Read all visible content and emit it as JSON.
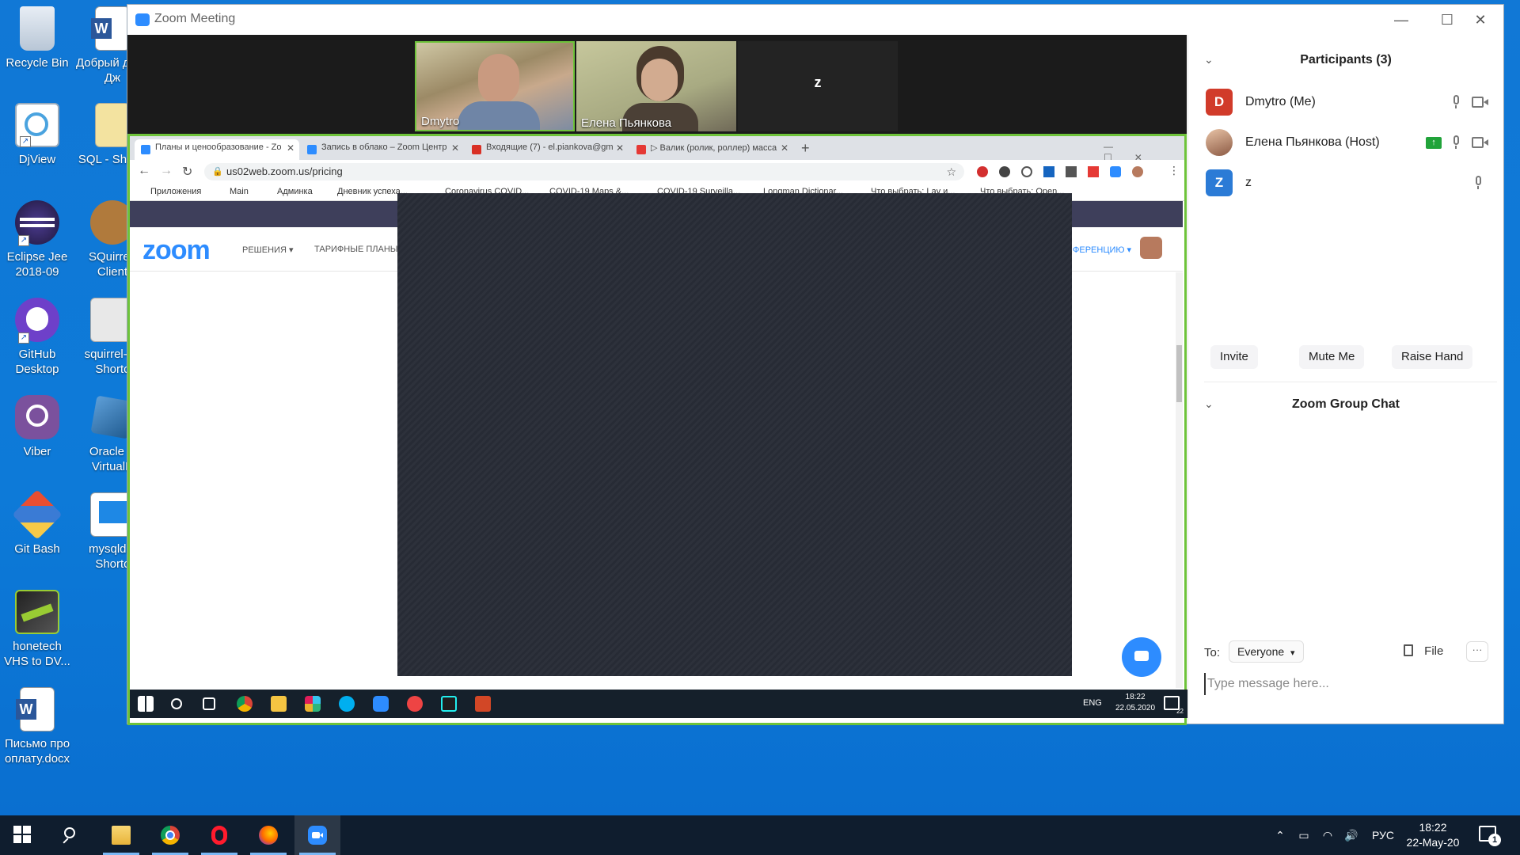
{
  "desktop": {
    "icons": [
      {
        "label": "Recycle Bin"
      },
      {
        "label": "DjView"
      },
      {
        "label": "Eclipse Jee 2018-09"
      },
      {
        "label": "GitHub Desktop"
      },
      {
        "label": "Viber"
      },
      {
        "label": "Git Bash"
      },
      {
        "label": "honetech VHS to DV..."
      },
      {
        "label": "Письмо про оплату.docx"
      },
      {
        "label": "Добрый день Дж"
      },
      {
        "label": "SQL - Shortc"
      },
      {
        "label": "SQuirreL Client"
      },
      {
        "label": "squirrel-s - Shortc"
      },
      {
        "label": "Oracle V VirtualB"
      },
      {
        "label": "mysqld.e Shortc"
      }
    ]
  },
  "zoom_window": {
    "title": "Zoom Meeting",
    "controls": {
      "minimize": "—",
      "maximize": "☐",
      "close": "✕"
    },
    "thumbnails": [
      {
        "name": "Dmytro"
      },
      {
        "name": "Елена Пьянкова"
      },
      {
        "name": "z"
      }
    ]
  },
  "shared_browser": {
    "tabs": [
      {
        "label": "Планы и ценообразование - Zo",
        "close": "✕"
      },
      {
        "label": "Запись в облако – Zoom Центр",
        "close": "✕"
      },
      {
        "label": "Входящие (7) - el.piankova@gm",
        "close": "✕"
      },
      {
        "label": "▷ Валик (ролик, роллер) масса",
        "close": "✕"
      }
    ],
    "new_tab": "+",
    "url": "us02web.zoom.us/pricing",
    "bookmarks": [
      "Приложения",
      "Main",
      "Админка",
      "Дневник успеха...",
      "Coronavirus COVID...",
      "COVID-19 Maps &...",
      "COVID-19 Surveilla...",
      "Longman Dictionar...",
      "Что выбрать: Lay и...",
      "Что выбрать: Open..."
    ],
    "page": {
      "logo": "zoom",
      "nav": [
        "РЕШЕНИЯ ▾",
        "ТАРИФНЫЕ ПЛАНЫ И",
        "ФЕРЕНЦИЮ ▾"
      ]
    },
    "inner_taskbar": {
      "lang": "ENG",
      "time": "18:22",
      "date": "22.05.2020",
      "notif_count": "22"
    }
  },
  "participants": {
    "header": "Participants (3)",
    "list": [
      {
        "initial": "D",
        "name": "Dmytro (Me)",
        "color": "#d13b2a"
      },
      {
        "initial": "",
        "name": "Елена Пьянкова (Host)",
        "color": "#b77a5e"
      },
      {
        "initial": "Z",
        "name": "z",
        "color": "#2b7bd6"
      }
    ],
    "buttons": {
      "invite": "Invite",
      "mute": "Mute Me",
      "raise": "Raise Hand"
    }
  },
  "chat": {
    "header": "Zoom Group Chat",
    "to_label": "To:",
    "to_value": "Everyone",
    "file_label": "File",
    "more": "···",
    "placeholder": "Type message here..."
  },
  "taskbar": {
    "lang": "РУС",
    "time": "18:22",
    "date": "22-May-20",
    "notif_count": "1"
  },
  "colors": {
    "zoom_blue": "#2d8cff",
    "share_border": "#6ec33a",
    "taskbar": "#0f1d2e"
  }
}
